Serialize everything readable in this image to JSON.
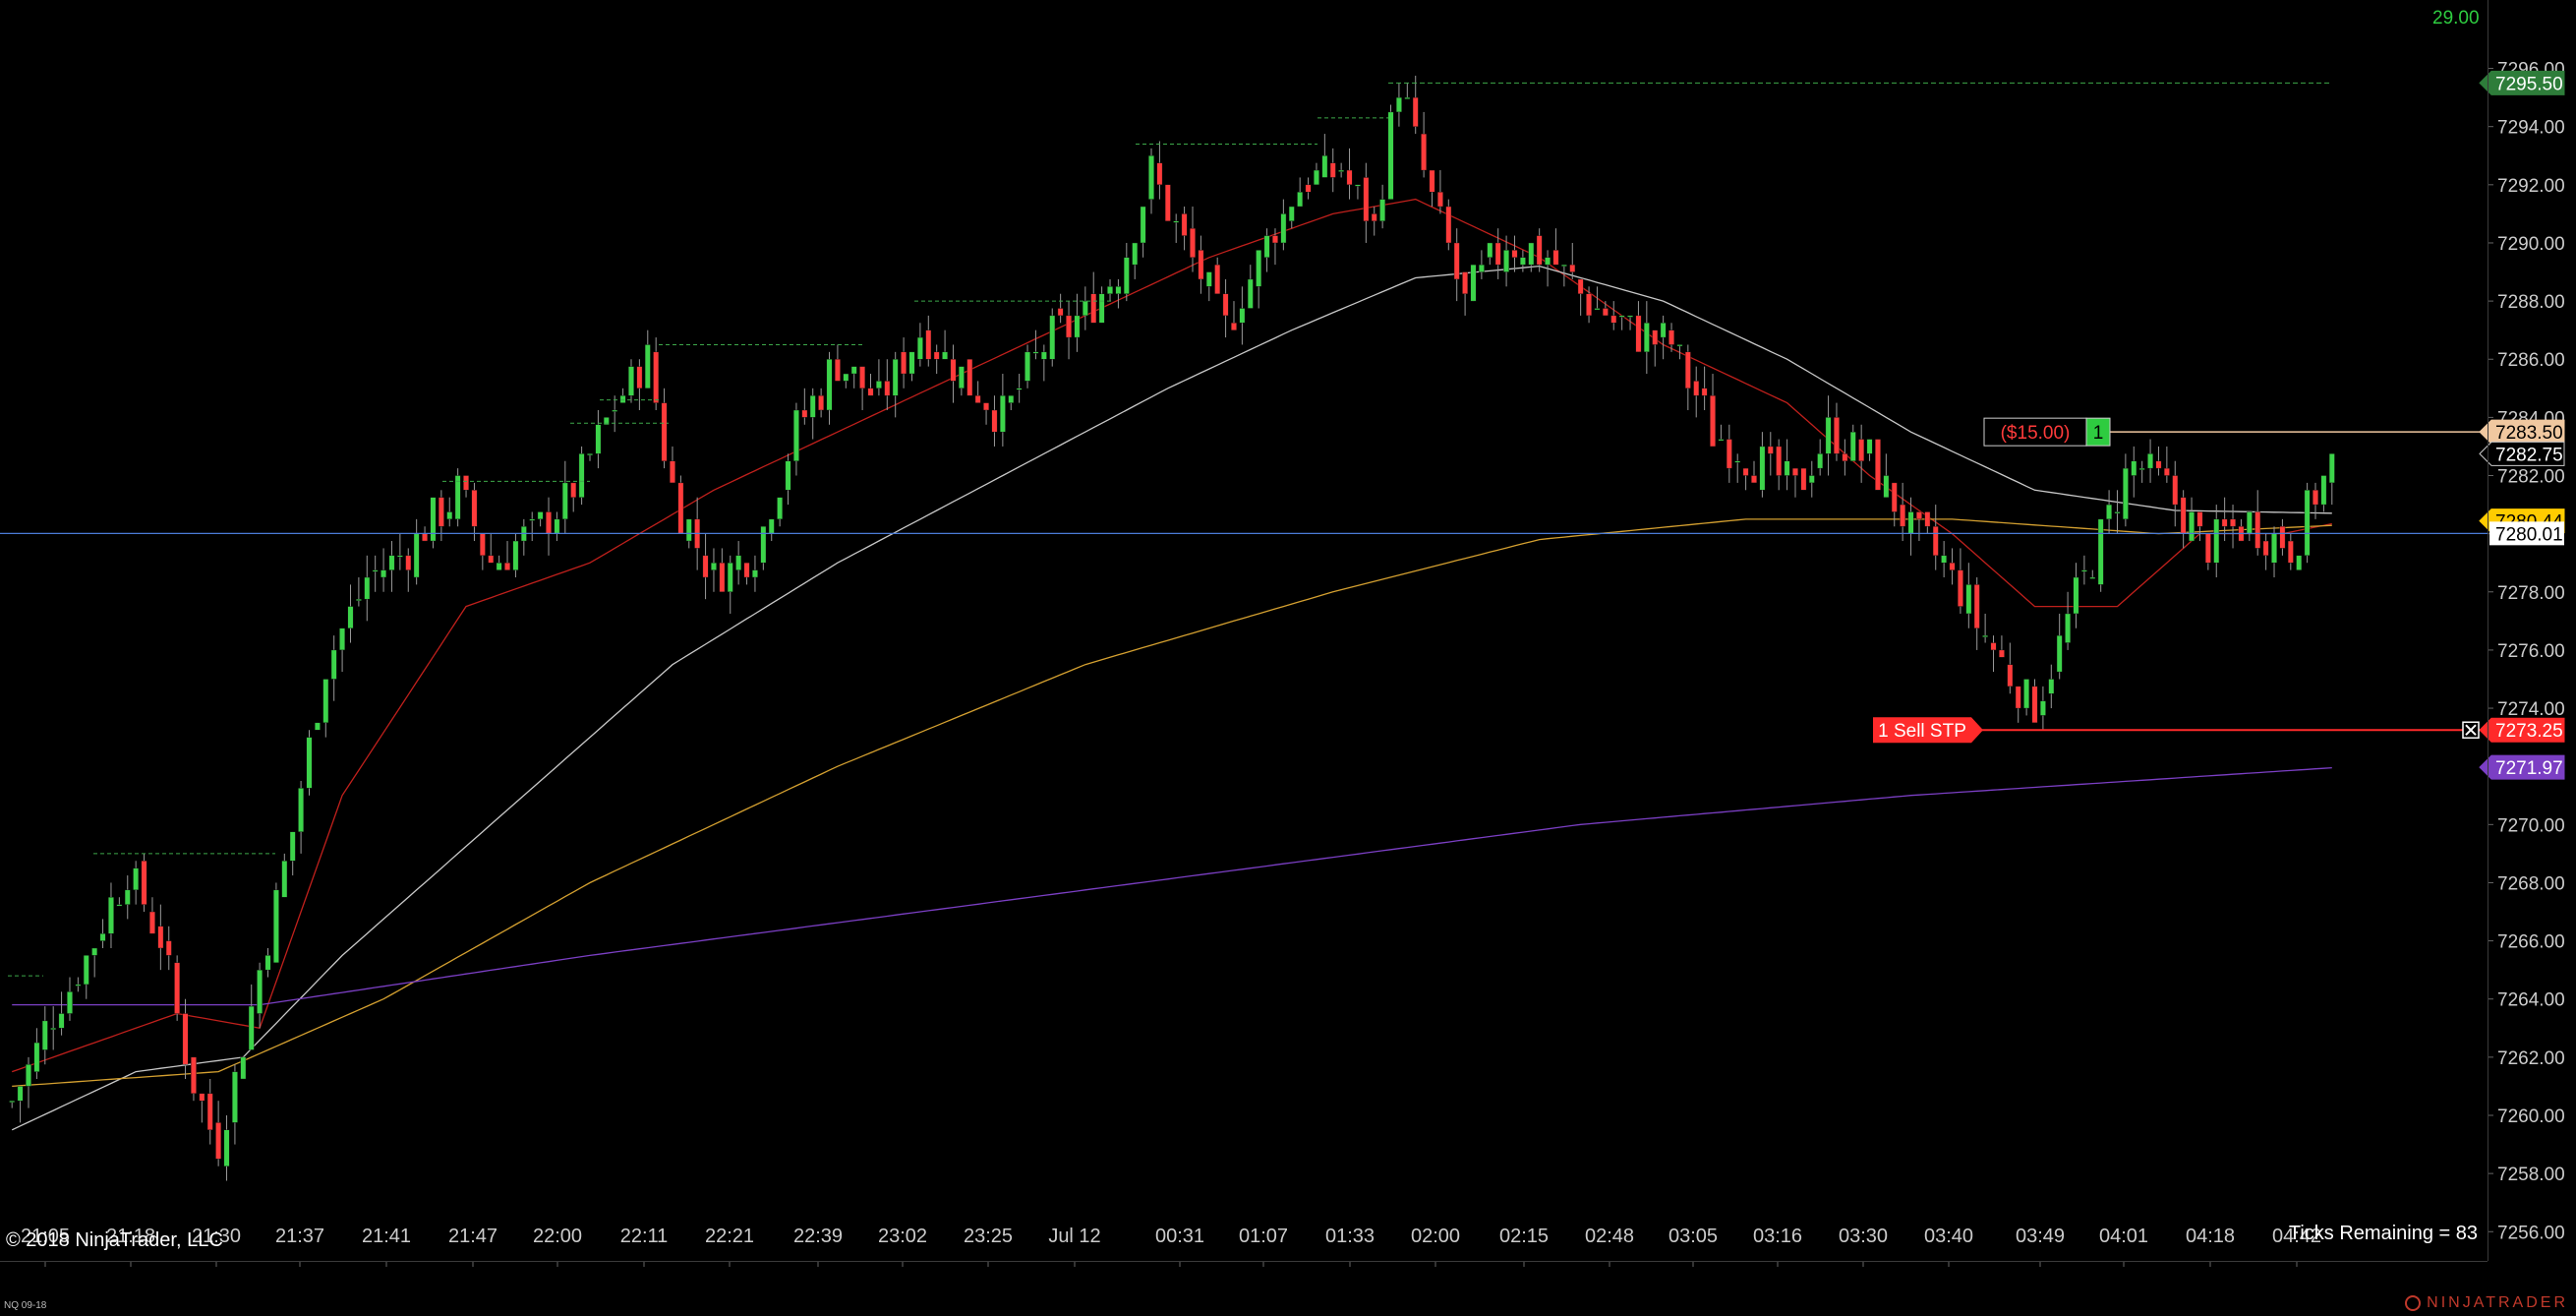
{
  "window": {
    "copyright": "© 2018 NinjaTrader, LLC",
    "ticks_remaining": "Ticks Remaining = 83",
    "top_right_value": "29.00",
    "instrument": "NQ 09-18",
    "brand": "NINJATRADER"
  },
  "colors": {
    "background": "#000000",
    "up_candle": "#3cd44a",
    "down_candle": "#ff3b3b",
    "ema_fast": "#c0201c",
    "ema_mid": "#c8c8c8",
    "ema_slow": "#d4a030",
    "ema_long": "#7b3fc4",
    "crosshair": "#4a7bd6",
    "axis_text": "#cccccc"
  },
  "position": {
    "pnl": "($15.00)",
    "qty": "1",
    "price_label": "7283.50"
  },
  "order": {
    "label": "1 Sell STP",
    "price_label": "7273.25",
    "close_icon": "close-icon"
  },
  "chart_data": {
    "type": "candlestick",
    "x_tick_labels": [
      "21:05",
      "21:18",
      "21:30",
      "21:37",
      "21:41",
      "21:47",
      "22:00",
      "22:11",
      "22:21",
      "22:39",
      "23:02",
      "23:25",
      "Jul 12",
      "00:31",
      "01:07",
      "01:33",
      "02:00",
      "02:15",
      "02:48",
      "03:05",
      "03:16",
      "03:30",
      "03:40",
      "03:49",
      "04:01",
      "04:18",
      "04:42"
    ],
    "y_ticks": [
      "7296.00",
      "7294.00",
      "7292.00",
      "7290.00",
      "7288.00",
      "7286.00",
      "7284.00",
      "7282.00",
      "7280.00",
      "7278.00",
      "7276.00",
      "7274.00",
      "7272.00",
      "7270.00",
      "7268.00",
      "7266.00",
      "7264.00",
      "7262.00",
      "7260.00",
      "7258.00",
      "7256.00"
    ],
    "ylim": [
      7255.4,
      7297.0
    ],
    "close_anchors": [
      [
        0,
        7260.5
      ],
      [
        5,
        7263.5
      ],
      [
        10,
        7266.0
      ],
      [
        14,
        7268.5
      ],
      [
        18,
        7266.0
      ],
      [
        22,
        7261.0
      ],
      [
        25,
        7259.0
      ],
      [
        28,
        7262.5
      ],
      [
        33,
        7268.5
      ],
      [
        38,
        7275.5
      ],
      [
        43,
        7278.5
      ],
      [
        48,
        7279.5
      ],
      [
        54,
        7281.5
      ],
      [
        58,
        7279.0
      ],
      [
        63,
        7280.0
      ],
      [
        68,
        7281.5
      ],
      [
        73,
        7284.5
      ],
      [
        77,
        7286.0
      ],
      [
        80,
        7281.5
      ],
      [
        85,
        7278.5
      ],
      [
        90,
        7279.5
      ],
      [
        95,
        7283.5
      ],
      [
        100,
        7286.0
      ],
      [
        105,
        7284.5
      ],
      [
        110,
        7287.0
      ],
      [
        115,
        7285.5
      ],
      [
        120,
        7284.0
      ],
      [
        125,
        7286.5
      ],
      [
        130,
        7287.5
      ],
      [
        134,
        7289.0
      ],
      [
        138,
        7292.5
      ],
      [
        142,
        7290.0
      ],
      [
        147,
        7287.0
      ],
      [
        151,
        7289.5
      ],
      [
        156,
        7292.0
      ],
      [
        161,
        7292.5
      ],
      [
        165,
        7290.5
      ],
      [
        168,
        7295.5
      ],
      [
        172,
        7291.5
      ],
      [
        176,
        7288.0
      ],
      [
        181,
        7290.0
      ],
      [
        186,
        7289.5
      ],
      [
        191,
        7288.0
      ],
      [
        196,
        7287.0
      ],
      [
        201,
        7286.5
      ],
      [
        206,
        7283.5
      ],
      [
        211,
        7282.5
      ],
      [
        216,
        7281.5
      ],
      [
        220,
        7283.5
      ],
      [
        225,
        7282.5
      ],
      [
        230,
        7280.0
      ],
      [
        234,
        7279.0
      ],
      [
        238,
        7277.0
      ],
      [
        242,
        7275.0
      ],
      [
        245,
        7274.0
      ],
      [
        249,
        7277.0
      ],
      [
        253,
        7280.0
      ],
      [
        257,
        7282.5
      ],
      [
        261,
        7281.5
      ],
      [
        266,
        7279.5
      ],
      [
        271,
        7280.5
      ],
      [
        276,
        7279.5
      ],
      [
        281,
        7282.5
      ]
    ],
    "bars": 282,
    "indicators": [
      {
        "name": "ema_fast",
        "color": "#c0201c",
        "values": [
          [
            0,
            7261.5
          ],
          [
            20,
            7263.5
          ],
          [
            30,
            7263.0
          ],
          [
            40,
            7271.0
          ],
          [
            55,
            7277.5
          ],
          [
            70,
            7279.0
          ],
          [
            85,
            7281.5
          ],
          [
            100,
            7283.5
          ],
          [
            115,
            7285.5
          ],
          [
            130,
            7287.5
          ],
          [
            145,
            7289.5
          ],
          [
            160,
            7291.0
          ],
          [
            170,
            7291.5
          ],
          [
            185,
            7289.5
          ],
          [
            200,
            7286.5
          ],
          [
            215,
            7284.5
          ],
          [
            225,
            7282.0
          ],
          [
            235,
            7280.0
          ],
          [
            245,
            7277.5
          ],
          [
            255,
            7277.5
          ],
          [
            265,
            7280.0
          ],
          [
            275,
            7280.0
          ],
          [
            282,
            7280.4
          ]
        ]
      },
      {
        "name": "ema_mid",
        "color": "#c8c8c8",
        "values": [
          [
            0,
            7259.5
          ],
          [
            15,
            7261.5
          ],
          [
            28,
            7262.0
          ],
          [
            40,
            7265.5
          ],
          [
            60,
            7270.5
          ],
          [
            80,
            7275.5
          ],
          [
            100,
            7279.0
          ],
          [
            120,
            7282.0
          ],
          [
            140,
            7285.0
          ],
          [
            155,
            7287.0
          ],
          [
            170,
            7288.8
          ],
          [
            185,
            7289.2
          ],
          [
            200,
            7288.0
          ],
          [
            215,
            7286.0
          ],
          [
            230,
            7283.5
          ],
          [
            245,
            7281.5
          ],
          [
            262,
            7280.8
          ],
          [
            282,
            7280.7
          ]
        ]
      },
      {
        "name": "ema_slow",
        "color": "#d4a030",
        "values": [
          [
            0,
            7261.0
          ],
          [
            25,
            7261.5
          ],
          [
            45,
            7264.0
          ],
          [
            70,
            7268.0
          ],
          [
            100,
            7272.0
          ],
          [
            130,
            7275.5
          ],
          [
            160,
            7278.0
          ],
          [
            185,
            7279.8
          ],
          [
            210,
            7280.5
          ],
          [
            235,
            7280.5
          ],
          [
            260,
            7280.0
          ],
          [
            282,
            7280.3
          ]
        ]
      },
      {
        "name": "ema_long",
        "color": "#7b3fc4",
        "values": [
          [
            0,
            7263.8
          ],
          [
            30,
            7263.8
          ],
          [
            70,
            7265.5
          ],
          [
            110,
            7267.0
          ],
          [
            150,
            7268.5
          ],
          [
            190,
            7270.0
          ],
          [
            230,
            7271.0
          ],
          [
            282,
            7271.97
          ]
        ]
      }
    ],
    "price_labels": [
      {
        "price": "7295.50",
        "bg": "#2e7d3a",
        "fg": "#ffffff"
      },
      {
        "price": "7283.50",
        "bg": "#f0c8a0",
        "fg": "#000000"
      },
      {
        "price": "7282.75",
        "bg": "#000000",
        "fg": "#ffffff",
        "border": "#cccccc"
      },
      {
        "price": "7280.44",
        "bg": "#ffcc00",
        "fg": "#000000"
      },
      {
        "price": "7273.25",
        "bg": "#ff2a2a",
        "fg": "#ffffff"
      },
      {
        "price": "7271.97",
        "bg": "#7b3fc4",
        "fg": "#ffffff"
      }
    ],
    "crosshair_price": "7280.01",
    "target_high": "7295.50"
  }
}
